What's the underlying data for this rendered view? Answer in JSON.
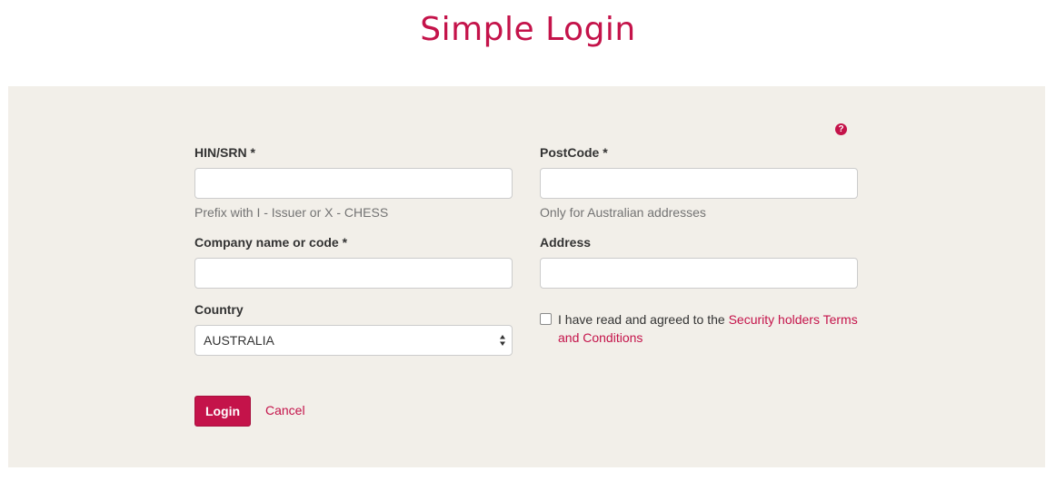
{
  "header": {
    "title": "Simple Login"
  },
  "form": {
    "help_icon": "question-icon",
    "hin": {
      "label": "HIN/SRN *",
      "value": "",
      "help": "Prefix with I - Issuer or X - CHESS"
    },
    "postcode": {
      "label": "PostCode *",
      "value": "",
      "help": "Only for Australian addresses"
    },
    "company": {
      "label": "Company name or code *",
      "value": ""
    },
    "address": {
      "label": "Address",
      "value": ""
    },
    "country": {
      "label": "Country",
      "selected": "AUSTRALIA"
    },
    "agree": {
      "checked": false,
      "text": "I have read and agreed to the ",
      "link_text": "Security holders Terms and Conditions"
    },
    "login_label": "Login",
    "cancel_label": "Cancel"
  },
  "colors": {
    "accent": "#c4134a",
    "panel_bg": "#f2efe9"
  }
}
